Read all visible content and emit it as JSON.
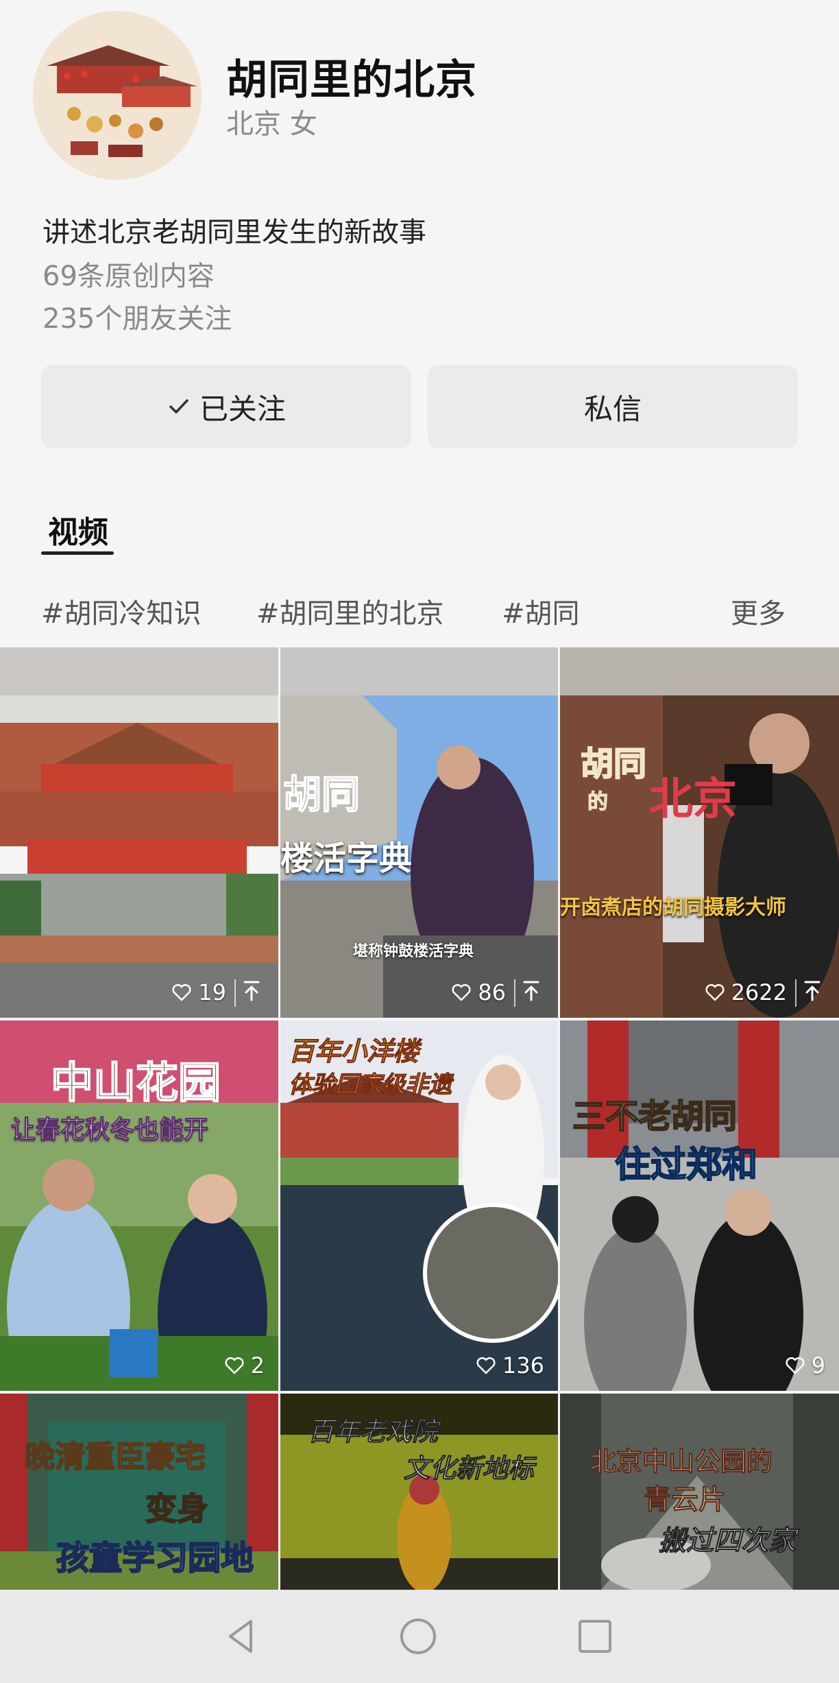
{
  "profile": {
    "name": "胡同里的北京",
    "meta": "北京 女",
    "bio": "讲述北京老胡同里发生的新故事",
    "original_count": "69条原创内容",
    "friends_follow": "235个朋友关注",
    "avatar_icon": "illustrated-hutong-avatar-icon"
  },
  "actions": {
    "follow_label": "已关注",
    "follow_icon": "checkmark-icon",
    "message_label": "私信"
  },
  "tabs": [
    {
      "label": "视频",
      "active": true
    }
  ],
  "tags": [
    "#胡同冷知识",
    "#胡同里的北京",
    "#胡同"
  ],
  "more_label": "更多",
  "videos": [
    {
      "likes": "19",
      "pinned": true,
      "overlay": []
    },
    {
      "likes": "86",
      "pinned": true,
      "overlay": [
        "胡同",
        "楼活字典",
        "堪称钟鼓楼活字典"
      ]
    },
    {
      "likes": "2622",
      "pinned": true,
      "overlay": [
        "胡同",
        "的",
        "北京",
        "开卤煮店的胡同摄影大师"
      ]
    },
    {
      "likes": "2",
      "pinned": false,
      "overlay": [
        "中山花园",
        "让春花秋冬也能开"
      ]
    },
    {
      "likes": "136",
      "pinned": false,
      "overlay": [
        "百年小洋楼",
        "体验国家级非遗"
      ]
    },
    {
      "likes": "9",
      "pinned": false,
      "overlay": [
        "三不老胡同",
        "住过郑和"
      ]
    },
    {
      "likes": "",
      "pinned": false,
      "overlay": [
        "晚清重臣豪宅",
        "变身",
        "孩童学习园地"
      ]
    },
    {
      "likes": "",
      "pinned": false,
      "overlay": [
        "百年老戏院",
        "文化新地标"
      ]
    },
    {
      "likes": "",
      "pinned": false,
      "overlay": [
        "北京中山公园的",
        "青云片",
        "搬过四次家"
      ]
    }
  ],
  "navbar": {
    "back_icon": "triangle-back-icon",
    "home_icon": "circle-home-icon",
    "recent_icon": "square-recents-icon"
  },
  "colors": {
    "background": "#f5f5f5",
    "button_bg": "#ebebeb",
    "muted_text": "#8a8a8a",
    "navbar_bg": "#e9e9e9"
  }
}
